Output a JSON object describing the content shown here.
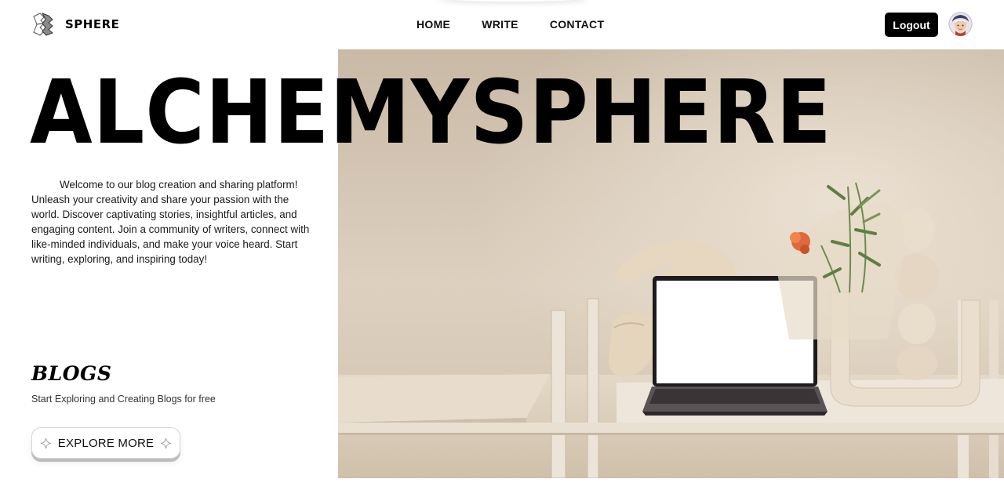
{
  "nav": {
    "brand_name": "SPHERE",
    "links": [
      "HOME",
      "WRITE",
      "CONTACT"
    ],
    "logout_label": "Logout",
    "logo_icon": "sphere-logo-icon",
    "avatar_icon": "user-avatar-icon"
  },
  "hero": {
    "title": "ALCHEMYSPHERE",
    "intro": "Welcome to our blog creation and sharing platform! Unleash your creativity and share your passion with the world. Discover captivating stories, insightful articles, and engaging content. Join a community of writers, connect with like-minded individuals, and make your voice heard. Start writing, exploring, and inspiring today!",
    "image_icon": "laptop-on-shelf-photo"
  },
  "blogs": {
    "heading": "BLOGS",
    "subtitle": "Start Exploring and Creating Blogs for free",
    "button_label": "EXPLORE MORE",
    "button_icon": "sparkle-icon"
  },
  "colors": {
    "accent": "#000000",
    "background": "#ffffff",
    "photo_wall": "#d8cab7"
  }
}
